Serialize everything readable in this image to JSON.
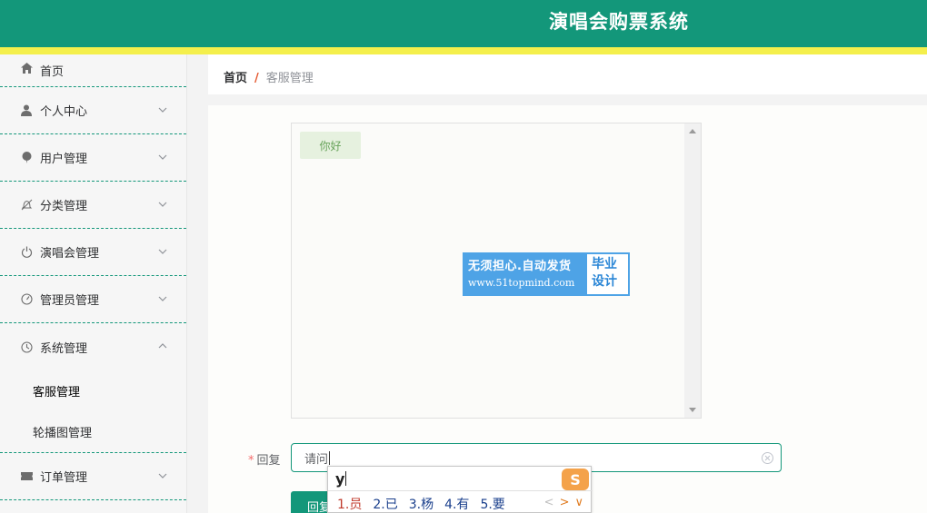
{
  "header": {
    "title": "演唱会购票系统"
  },
  "sidebar": {
    "items": [
      {
        "label": "首页",
        "icon": "home-icon"
      },
      {
        "label": "个人中心",
        "icon": "user-icon"
      },
      {
        "label": "用户管理",
        "icon": "balloon-icon"
      },
      {
        "label": "分类管理",
        "icon": "bell-off-icon"
      },
      {
        "label": "演唱会管理",
        "icon": "power-icon"
      },
      {
        "label": "管理员管理",
        "icon": "gauge-icon"
      },
      {
        "label": "系统管理",
        "icon": "clock-icon"
      },
      {
        "label": "订单管理",
        "icon": "ticket-icon"
      }
    ],
    "submenu": [
      {
        "label": "客服管理"
      },
      {
        "label": "轮播图管理"
      }
    ]
  },
  "breadcrumb": {
    "home": "首页",
    "separator": "/",
    "current": "客服管理"
  },
  "chat": {
    "messages": [
      {
        "text": "你好"
      }
    ],
    "watermark": {
      "line1": "无须担心.自动发货",
      "line2": "www.51topmind.com",
      "right1": "毕业",
      "right2": "设计"
    }
  },
  "form": {
    "reply_label": "回复",
    "required_mark": "*",
    "reply_value": "请问",
    "submit_label": "回复"
  },
  "ime": {
    "pinyin": "y",
    "candidates": [
      "1.员",
      "2.已",
      "3.杨",
      "4.有",
      "5.要"
    ],
    "prev": "<",
    "next": ">",
    "more": "∨",
    "logo": "S"
  },
  "colors": {
    "primary": "#13977a",
    "accent_bar": "#f4ef4c",
    "breadcrumb_sep": "#e4572e"
  }
}
